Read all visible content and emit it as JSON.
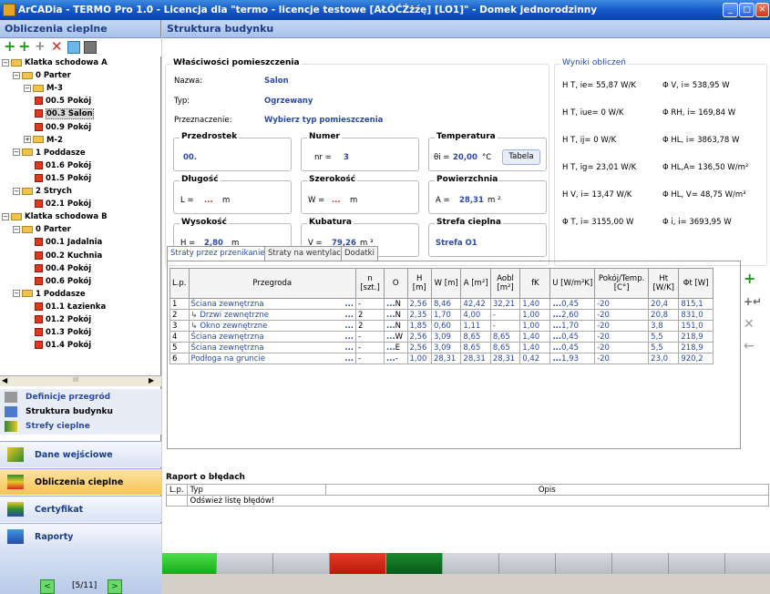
{
  "window": {
    "title": "ArCADia - TERMO Pro 1.0 - Licencja dla \"termo - licencje testowe [AŁÓĆŹżźę] [LO1]\" - Domek jednorodzinny"
  },
  "left": {
    "header": "Obliczenia cieplne",
    "tree": [
      {
        "label": "Klatka schodowa A",
        "kind": "folder",
        "exp": "−"
      },
      {
        "label": "0 Parter",
        "kind": "folder",
        "exp": "−"
      },
      {
        "label": "M-3",
        "kind": "folder",
        "exp": "−"
      },
      {
        "label": "00.5 Pokój",
        "kind": "room"
      },
      {
        "label": "00.3 Salon",
        "kind": "room",
        "selected": true
      },
      {
        "label": "00.9 Pokój",
        "kind": "room"
      },
      {
        "label": "M-2",
        "kind": "folder",
        "exp": "+"
      },
      {
        "label": "1 Poddasze",
        "kind": "folder",
        "exp": "−"
      },
      {
        "label": "01.6 Pokój",
        "kind": "room"
      },
      {
        "label": "01.5 Pokój",
        "kind": "room"
      },
      {
        "label": "2 Strych",
        "kind": "folder",
        "exp": "−"
      },
      {
        "label": "02.1 Pokój",
        "kind": "room"
      },
      {
        "label": "Klatka schodowa B",
        "kind": "folder",
        "exp": "−"
      },
      {
        "label": "0 Parter",
        "kind": "folder",
        "exp": "−"
      },
      {
        "label": "00.1 Jadalnia",
        "kind": "room"
      },
      {
        "label": "00.2 Kuchnia",
        "kind": "room"
      },
      {
        "label": "00.4 Pokój",
        "kind": "room"
      },
      {
        "label": "00.6 Pokój",
        "kind": "room"
      },
      {
        "label": "1 Poddasze",
        "kind": "folder",
        "exp": "−"
      },
      {
        "label": "01.1 Łazienka",
        "kind": "room"
      },
      {
        "label": "01.2 Pokój",
        "kind": "room"
      },
      {
        "label": "01.3 Pokój",
        "kind": "room"
      },
      {
        "label": "01.4 Pokój",
        "kind": "room"
      }
    ],
    "hscroll_dots": "III",
    "nav_small": [
      "Definicje przegród",
      "Struktura budynku",
      "Strefy cieplne"
    ],
    "nav_big": [
      "Dane wejściowe",
      "Obliczenia cieplne",
      "Certyfikat",
      "Raporty"
    ],
    "pager": {
      "label": "[5/11]",
      "prev": "<",
      "next": ">"
    }
  },
  "main": {
    "header": "Struktura budynku",
    "props": {
      "title": "Właściwości pomieszczenia",
      "nazwa_label": "Nazwa:",
      "nazwa": "Salon",
      "typ_label": "Typ:",
      "typ": "Ogrzewany",
      "przezn_label": "Przeznaczenie:",
      "przezn": "Wybierz typ pomieszczenia",
      "przedrostek_title": "Przedrostek",
      "przedrostek": "00.",
      "numer_title": "Numer",
      "numer_label": "nr =",
      "numer": "3",
      "temp_title": "Temperatura",
      "temp_label": "θi =",
      "temp": "20,00",
      "temp_unit": "°C",
      "tabela": "Tabela",
      "dlug_title": "Długość",
      "dlug_label": "L =",
      "dlug": "...",
      "dlug_unit": "m",
      "szer_title": "Szerokość",
      "szer_label": "W =",
      "szer": "...",
      "szer_unit": "m",
      "pow_title": "Powierzchnia",
      "pow_label": "A =",
      "pow": "28,31",
      "pow_unit": "m ²",
      "wys_title": "Wysokość",
      "wys_label": "H =",
      "wys": "2,80",
      "wys_unit": "m",
      "kub_title": "Kubatura",
      "kub_label": "V =",
      "kub": "79,26",
      "kub_unit": "m ³",
      "strefa_title": "Strefa cieplna",
      "strefa": "Strefa O1"
    },
    "results": {
      "title": "Wyniki obliczeń",
      "left": [
        "H T, ie= 55,87 W/K",
        "H T, iue= 0 W/K",
        "H T, ij= 0 W/K",
        "H T, ig= 23,01 W/K",
        "H V, i= 13,47 W/K",
        "Φ T, i= 3155,00 W"
      ],
      "right": [
        "Φ V, i= 538,95 W",
        "Φ RH, i= 169,84 W",
        "Φ HL, i= 3863,78 W",
        "Φ HL,A= 136,50 W/m²",
        "Φ HL, V= 48,75 W/m³",
        "Φ i, i= 3693,95 W"
      ]
    },
    "tabs": [
      "Straty przez przenikanie",
      "Straty na wentylacji",
      "Dodatki"
    ],
    "table": {
      "headers": [
        "L.p.",
        "Przegroda",
        "n [szt.]",
        "O",
        "H [m]",
        "W [m]",
        "A [m²]",
        "Aobl [m²]",
        "fK",
        "U [W/m²K]",
        "Pokój/Temp. [C°]",
        "Ht [W/K]",
        "Φt [W]"
      ],
      "rows": [
        [
          "1",
          "Ściana zewnętrzna",
          "-",
          "N",
          "2,56",
          "8,46",
          "42,42",
          "32,21",
          "1,40",
          "0,45",
          "-20",
          "20,4",
          "815,1"
        ],
        [
          "2",
          "↳ Drzwi zewnętrzne",
          "2",
          "N",
          "2,35",
          "1,70",
          "4,00",
          "-",
          "1,00",
          "2,60",
          "-20",
          "20,8",
          "831,0"
        ],
        [
          "3",
          "↳ Okno zewnętrzne",
          "2",
          "N",
          "1,85",
          "0,60",
          "1,11",
          "-",
          "1,00",
          "1,70",
          "-20",
          "3,8",
          "151,0"
        ],
        [
          "4",
          "Ściana zewnętrzna",
          "-",
          "W",
          "2,56",
          "3,09",
          "8,65",
          "8,65",
          "1,40",
          "0,45",
          "-20",
          "5,5",
          "218,9"
        ],
        [
          "5",
          "Ściana zewnętrzna",
          "-",
          "E",
          "2,56",
          "3,09",
          "8,65",
          "8,65",
          "1,40",
          "0,45",
          "-20",
          "5,5",
          "218,9"
        ],
        [
          "6",
          "Podłoga na gruncie",
          "-",
          "-",
          "1,00",
          "28,31",
          "28,31",
          "28,31",
          "0,42",
          "1,93",
          "-20",
          "23,0",
          "920,2"
        ]
      ],
      "dots": "..."
    },
    "errors": {
      "title": "Raport o błędach",
      "h_lp": "L.p.",
      "h_typ": "Typ",
      "h_opis": "Opis",
      "msg": "Odśwież listę błędów!"
    }
  }
}
